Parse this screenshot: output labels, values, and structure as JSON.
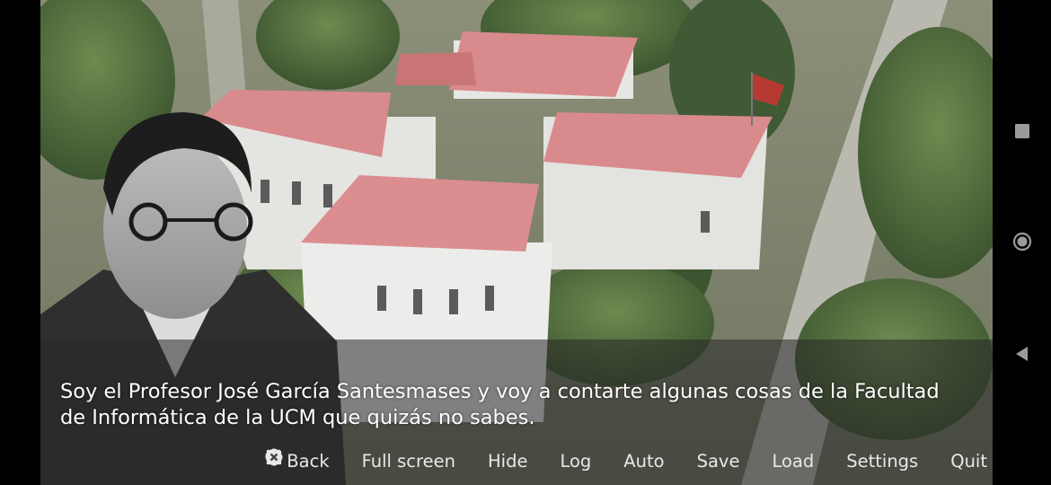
{
  "dialogue": {
    "text": "Soy el Profesor José García Santesmases y voy a contarte algunas cosas de la Facultad de Informática de la UCM que quizás no sabes."
  },
  "quick_menu": [
    {
      "id": "back",
      "label": "Back",
      "icon": "arrow-left-icon"
    },
    {
      "id": "fullscreen",
      "label": "Full screen",
      "icon": "expand-icon"
    },
    {
      "id": "hide",
      "label": "Hide",
      "icon": "eye-icon"
    },
    {
      "id": "log",
      "label": "Log",
      "icon": "chat-bubbles-icon"
    },
    {
      "id": "auto",
      "label": "Auto",
      "icon": "play-circle-icon"
    },
    {
      "id": "save",
      "label": "Save",
      "icon": "floppy-disk-icon"
    },
    {
      "id": "load",
      "label": "Load",
      "icon": "undo-arrow-icon"
    },
    {
      "id": "settings",
      "label": "Settings",
      "icon": "gear-icon"
    },
    {
      "id": "quit",
      "label": "Quit",
      "icon": "close-circle-icon"
    }
  ],
  "android_nav": [
    {
      "id": "recents",
      "icon": "square-icon"
    },
    {
      "id": "home",
      "icon": "circle-icon"
    },
    {
      "id": "back",
      "icon": "triangle-back-icon"
    }
  ],
  "colors": {
    "dialogue_bg": "rgba(40,40,40,0.55)",
    "text": "#ffffff",
    "menu_text": "#e8e8e8",
    "roof": "#d98a8d",
    "nav_icon": "#9a9a9a"
  }
}
